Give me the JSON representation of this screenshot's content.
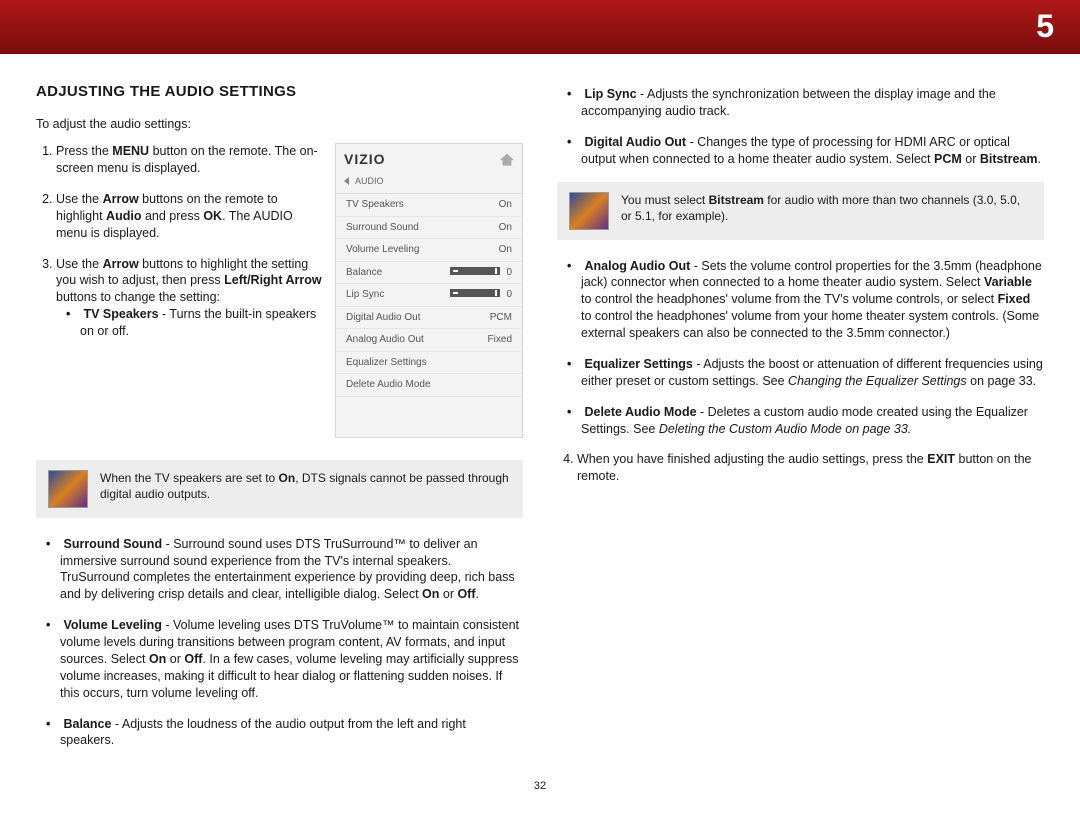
{
  "chapter_number": "5",
  "page_number": "32",
  "heading": "ADJUSTING THE AUDIO SETTINGS",
  "intro": "To adjust the audio settings:",
  "step1": {
    "pre": "Press the ",
    "b1": "MENU",
    "post": " button on the remote. The on-screen menu is displayed."
  },
  "step2": {
    "pre": "Use the ",
    "b1": "Arrow",
    "mid1": " buttons on the remote to highlight ",
    "b2": "Audio",
    "mid2": " and press ",
    "b3": "OK",
    "post": ". The AUDIO menu is displayed."
  },
  "step3": {
    "pre": "Use the ",
    "b1": "Arrow",
    "mid1": " buttons to highlight the setting you wish to adjust, then press ",
    "b2": "Left/Right Arrow",
    "post": " buttons to change the setting:"
  },
  "tv_speakers": {
    "label": "TV Speakers",
    "desc": " - Turns the built-in speakers on or off."
  },
  "callout1": {
    "pre": "When the TV speakers are set to ",
    "b": "On",
    "post": ", DTS signals cannot be passed through digital audio outputs."
  },
  "surround": {
    "label": "Surround Sound",
    "desc_a": " - Surround sound uses DTS TruSurround™ to deliver an immersive surround sound experience from the TV's internal speakers. TruSurround completes the entertainment experience by providing deep, rich bass and by delivering crisp details and clear, intelligible dialog. Select ",
    "on": "On",
    "or": " or ",
    "off": "Off",
    "dot": "."
  },
  "volume_leveling": {
    "label": "Volume Leveling",
    "desc_a": " - Volume leveling uses DTS TruVolume™ to maintain consistent volume levels during transitions between program content, AV formats, and input sources. Select ",
    "on": "On",
    "or": " or ",
    "off": "Off",
    "desc_b": ". In a few cases, volume leveling may artificially suppress volume increases, making it difficult to hear dialog or flattening sudden noises. If this occurs, turn volume leveling off."
  },
  "balance": {
    "label": "Balance",
    "desc": " - Adjusts the loudness of the audio output from the left and right speakers."
  },
  "lipsync": {
    "label": "Lip Sync",
    "desc": " - Adjusts the synchronization between the display image and the accompanying audio track."
  },
  "digital_audio_out": {
    "label": "Digital Audio Out",
    "desc_a": " - Changes the type of processing for HDMI ARC or optical output when connected to a home theater audio system. Select ",
    "pcm": "PCM",
    "or": " or ",
    "bitstream": "Bitstream",
    "dot": "."
  },
  "callout2": {
    "pre": "You must select ",
    "b": "Bitstream",
    "post": " for audio with more than two channels (3.0, 5.0, or 5.1, for example)."
  },
  "analog_audio_out": {
    "label": "Analog Audio Out",
    "desc_a": " - Sets the volume control properties for the 3.5mm (headphone jack) connector when connected to a home theater audio system. Select ",
    "variable": "Variable",
    "desc_b": " to control the headphones' volume from the TV's volume controls, or select ",
    "fixed": "Fixed",
    "desc_c": " to control the headphones' volume from your home theater system controls. (Some external speakers can also be connected to the 3.5mm connector.)"
  },
  "equalizer": {
    "label": "Equalizer Settings",
    "desc_a": " - Adjusts the boost or attenuation of different frequencies using either preset or custom settings. See ",
    "ref": "Changing the Equalizer Settings",
    "desc_b": " on page 33."
  },
  "delete_mode": {
    "label": "Delete Audio Mode",
    "desc_a": " - Deletes a custom audio mode created using the Equalizer Settings. See ",
    "ref": "Deleting the Custom Audio Mode on page 33."
  },
  "step4": {
    "pre": "When you have finished adjusting the audio settings, press the ",
    "b": "EXIT",
    "post": " button on the remote."
  },
  "menu": {
    "brand": "VIZIO",
    "section": "AUDIO",
    "rows": {
      "tv_speakers": {
        "label": "TV Speakers",
        "value": "On"
      },
      "surround": {
        "label": "Surround Sound",
        "value": "On"
      },
      "vol_level": {
        "label": "Volume Leveling",
        "value": "On"
      },
      "balance": {
        "label": "Balance",
        "value": "0"
      },
      "lip_sync": {
        "label": "Lip Sync",
        "value": "0"
      },
      "digital": {
        "label": "Digital Audio Out",
        "value": "PCM"
      },
      "analog": {
        "label": "Analog Audio Out",
        "value": "Fixed"
      },
      "eq": {
        "label": "Equalizer Settings"
      },
      "delete": {
        "label": "Delete Audio Mode"
      }
    }
  }
}
